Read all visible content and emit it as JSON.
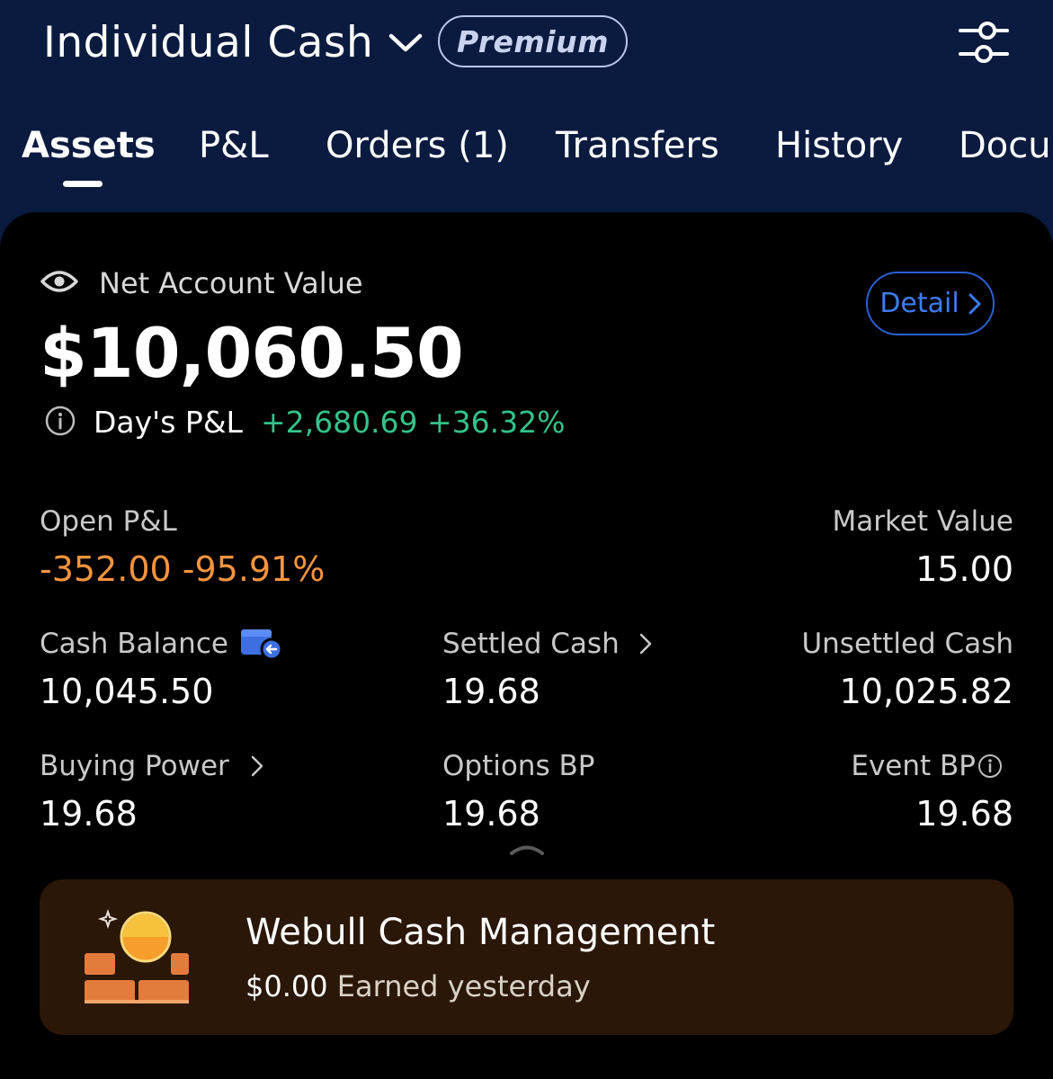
{
  "header": {
    "account_name": "Individual Cash",
    "badge": "Premium",
    "tabs": [
      "Assets",
      "P&L",
      "Orders (1)",
      "Transfers",
      "History",
      "Documents"
    ],
    "active_tab": "Assets"
  },
  "summary": {
    "net_label": "Net Account Value",
    "net_value": "$10,060.50",
    "detail_label": "Detail",
    "days_pl_label": "Day's P&L",
    "days_pl_value": "+2,680.69 +36.32%"
  },
  "metrics": {
    "open_pl": {
      "label": "Open P&L",
      "value": "-352.00 -95.91%"
    },
    "market_value": {
      "label": "Market Value",
      "value": "15.00"
    },
    "cash_balance": {
      "label": "Cash Balance",
      "value": "10,045.50"
    },
    "settled_cash": {
      "label": "Settled Cash",
      "value": "19.68"
    },
    "unsettled_cash": {
      "label": "Unsettled Cash",
      "value": "10,025.82"
    },
    "buying_power": {
      "label": "Buying Power",
      "value": "19.68"
    },
    "options_bp": {
      "label": "Options BP",
      "value": "19.68"
    },
    "event_bp": {
      "label": "Event BP",
      "value": "19.68"
    }
  },
  "promo": {
    "title": "Webull Cash Management",
    "amount": "$0.00",
    "caption": "Earned yesterday"
  },
  "colors": {
    "header_bg": "#0b1b3f",
    "positive": "#35c28a",
    "negative": "#f5943e",
    "accent": "#3d7cf5",
    "promo_bg": "#2a1707"
  }
}
